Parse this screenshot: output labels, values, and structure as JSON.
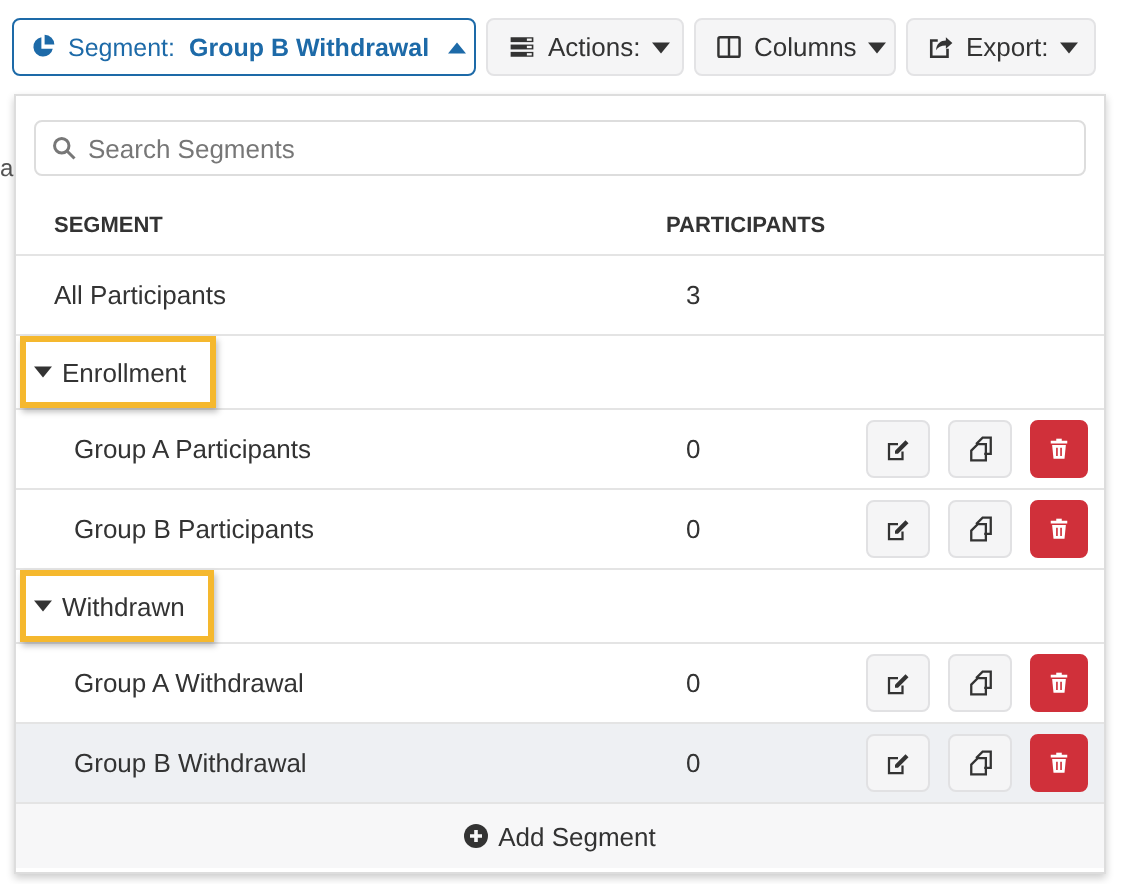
{
  "toolbar": {
    "segment": {
      "label": "Segment:",
      "value": "Group B Withdrawal",
      "expanded": true
    },
    "buttons": [
      {
        "kind": "actions",
        "label": "Actions:"
      },
      {
        "kind": "columns",
        "label": "Columns"
      },
      {
        "kind": "export",
        "label": "Export:"
      }
    ]
  },
  "background_fragment": "a",
  "dropdown": {
    "search": {
      "placeholder": "Search Segments"
    },
    "columns": [
      "SEGMENT",
      "PARTICIPANTS"
    ],
    "rows": [
      {
        "kind": "fixed",
        "name": "All Participants",
        "count": "3",
        "selected": false
      },
      {
        "kind": "group",
        "name": "Enrollment",
        "expanded": true,
        "highlighted": true,
        "children": [
          {
            "kind": "custom",
            "name": "Group A Participants",
            "count": "0",
            "selected": false
          },
          {
            "kind": "custom",
            "name": "Group B Participants",
            "count": "0",
            "selected": false
          }
        ]
      },
      {
        "kind": "group",
        "name": "Withdrawn",
        "expanded": true,
        "highlighted": true,
        "children": [
          {
            "kind": "custom",
            "name": "Group A Withdrawal",
            "count": "0",
            "selected": false
          },
          {
            "kind": "custom",
            "name": "Group B Withdrawal",
            "count": "0",
            "selected": true
          }
        ]
      }
    ],
    "add_button": "Add Segment"
  }
}
